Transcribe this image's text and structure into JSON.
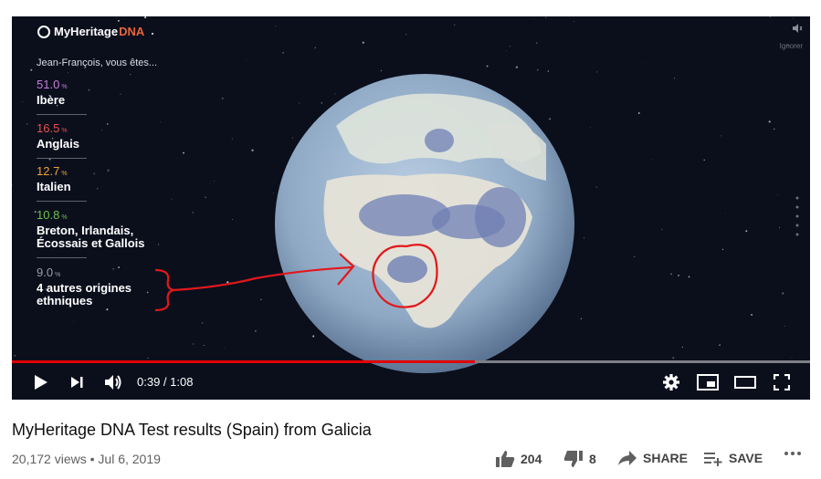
{
  "player": {
    "brand": {
      "name": "MyHeritage",
      "suffix": "DNA"
    },
    "greeting": "Jean-François, vous êtes...",
    "ethnicities": [
      {
        "pct": "51.0",
        "unit": "%",
        "name_lines": [
          "Ibère"
        ],
        "color": "#c77dde"
      },
      {
        "pct": "16.5",
        "unit": "%",
        "name_lines": [
          "Anglais"
        ],
        "color": "#e8504b"
      },
      {
        "pct": "12.7",
        "unit": "%",
        "name_lines": [
          "Italien"
        ],
        "color": "#f0a238"
      },
      {
        "pct": "10.8",
        "unit": "%",
        "name_lines": [
          "Breton, Irlandais,",
          "Écossais et Gallois"
        ],
        "color": "#6bc24e"
      },
      {
        "pct": "9.0",
        "unit": "%",
        "name_lines": [
          "4 autres origines",
          "ethniques"
        ],
        "color": "#9a9ea8"
      }
    ],
    "time": "0:39 / 1:08",
    "progress_fraction": 0.58,
    "ignorer": "Ignorer",
    "annotation_color": "#e3171b"
  },
  "video": {
    "title": "MyHeritage DNA Test results (Spain) from Galicia",
    "views": "20,172 views",
    "separator": "•",
    "date": "Jul 6, 2019",
    "likes": "204",
    "dislikes": "8",
    "share_label": "SHARE",
    "save_label": "SAVE"
  },
  "icons": {
    "play": "play-icon",
    "next": "next-icon",
    "volume": "volume-icon",
    "settings": "gear-icon",
    "miniplayer": "miniplayer-icon",
    "theater": "theater-icon",
    "fullscreen": "fullscreen-icon",
    "like": "thumbs-up-icon",
    "dislike": "thumbs-down-icon",
    "share": "share-icon",
    "save": "playlist-add-icon",
    "more": "more-icon"
  }
}
